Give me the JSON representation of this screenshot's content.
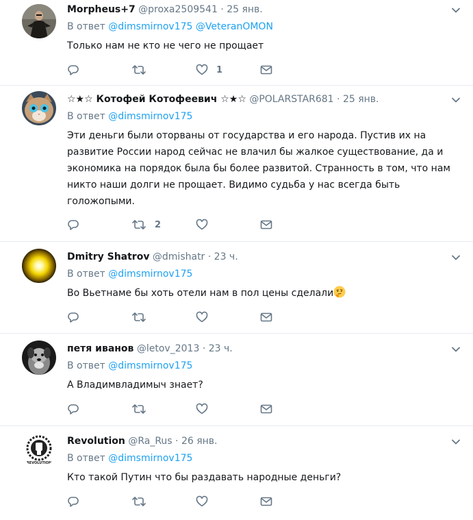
{
  "tweets": [
    {
      "name": "Morpheus+7",
      "handle": "@proxa2509541",
      "sep": "·",
      "time": "25 янв.",
      "reply_prefix": "В ответ",
      "mentions": [
        "@dimsmirnov175",
        "@VeteranOMON"
      ],
      "text": "Только нам не кто не чего не прощает",
      "retweets": "",
      "likes": "1"
    },
    {
      "name": "☆★☆ Котофей Котофеевич ☆★☆",
      "handle": "@POLARSTAR681",
      "sep": "·",
      "time": "25 янв.",
      "reply_prefix": "В ответ",
      "mentions": [
        "@dimsmirnov175"
      ],
      "text": "Эти деньги были оторваны от государства и его народа. Пустив их на развитие России народ сейчас не влачил бы жалкое существование, да и экономика на порядок была бы более развитой. Странность в том, что нам никто наши долги не прощает. Видимо судьба у нас всегда быть голожопыми.",
      "retweets": "2",
      "likes": ""
    },
    {
      "name": "Dmitry Shatrov",
      "handle": "@dmishatr",
      "sep": "·",
      "time": "23 ч.",
      "reply_prefix": "В ответ",
      "mentions": [
        "@dimsmirnov175"
      ],
      "text": "Во Вьетнаме бы хоть отели нам в пол цены сделали",
      "retweets": "",
      "likes": ""
    },
    {
      "name": "петя иванов",
      "handle": "@letov_2013",
      "sep": "·",
      "time": "23 ч.",
      "reply_prefix": "В ответ",
      "mentions": [
        "@dimsmirnov175"
      ],
      "text": "А Владимвладимыч знает?",
      "retweets": "",
      "likes": ""
    },
    {
      "name": "Revolution",
      "handle": "@Ra_Rus",
      "sep": "·",
      "time": "26 янв.",
      "reply_prefix": "В ответ",
      "mentions": [
        "@dimsmirnov175"
      ],
      "text": "Кто такой Путин что бы раздавать народные деньги?",
      "retweets": "",
      "likes": "",
      "avatar_text": "REVOLUTION"
    }
  ],
  "colors": {
    "link": "#1da1f2",
    "secondary": "#657786",
    "text": "#14171a",
    "divider": "#e6ecf0"
  },
  "icons": [
    "reply-icon",
    "retweet-icon",
    "like-icon",
    "direct-message-icon",
    "caret-down-icon",
    "thinking-face-emoji"
  ]
}
